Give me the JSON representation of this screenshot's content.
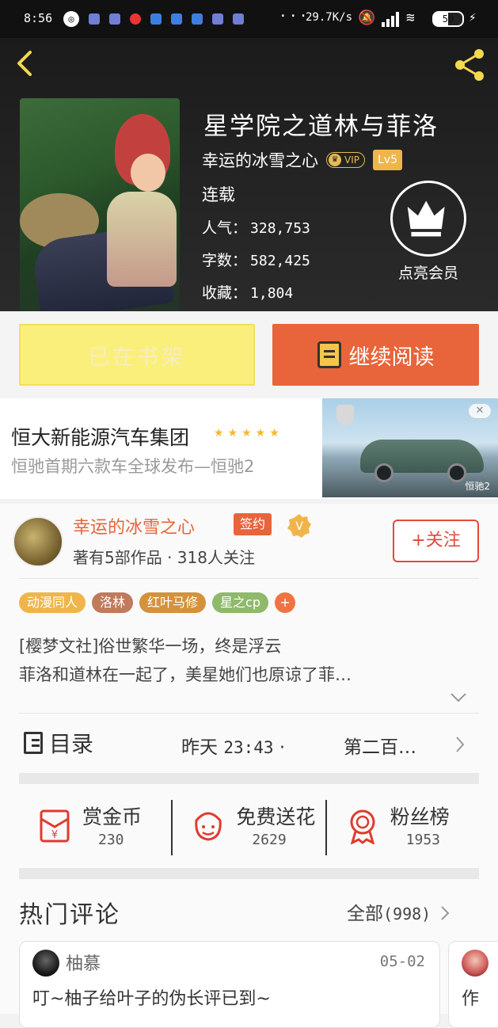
{
  "status_bar": {
    "time": "8:56",
    "speed": "29.7K/s",
    "battery": "50"
  },
  "book": {
    "title": "星学院之道林与菲洛",
    "author": "幸运的冰雪之心",
    "vip_label": "VIP",
    "level": "Lv5",
    "status": "连载",
    "popularity_label": "人气：",
    "popularity": "328,753",
    "words_label": "字数：",
    "words": "582,425",
    "favorites_label": "收藏：",
    "favorites": "1,804",
    "member_label": "点亮会员"
  },
  "actions": {
    "shelf_label": "已在书架",
    "read_label": "继续阅读"
  },
  "ad": {
    "title": "恒大新能源汽车集团",
    "stars": "★★★★★",
    "subtitle": "恒驰首期六款车全球发布—恒驰2",
    "image_tag": "恒驰2",
    "close_label": "✕"
  },
  "author_card": {
    "name": "幸运的冰雪之心",
    "sign_label": "签约",
    "works_text": "著有5部作品 · 318人关注",
    "follow_label": "+关注"
  },
  "tags": [
    "动漫同人",
    "洛林",
    "红叶马修",
    "星之cp",
    "+"
  ],
  "description": {
    "line1": "[樱梦文社]俗世繁华一场，终是浮云",
    "line2": "菲洛和道林在一起了，美星她们也原谅了菲…"
  },
  "toc": {
    "label": "目录",
    "time_prefix": "昨天",
    "time": "23:43",
    "separator": "·",
    "latest_chapter": "第二百…"
  },
  "gifts": [
    {
      "label": "赏金币",
      "value": "230",
      "icon": "red-envelope-icon"
    },
    {
      "label": "免费送花",
      "value": "2629",
      "icon": "flower-icon"
    },
    {
      "label": "粉丝榜",
      "value": "1953",
      "icon": "medal-icon"
    }
  ],
  "comments": {
    "title": "热门评论",
    "all_label": "全部",
    "all_count": "(998)",
    "items": [
      {
        "user": "柚慕",
        "date": "05-02",
        "text": "叮~柚子给叶子的伪长评已到~"
      },
      {
        "user": "",
        "date": "",
        "text": "作"
      }
    ]
  },
  "colors": {
    "accent": "#e8643a",
    "shelf_bg": "#fbef7c",
    "follow": "#e24a3b",
    "gold": "#f0b54a"
  }
}
